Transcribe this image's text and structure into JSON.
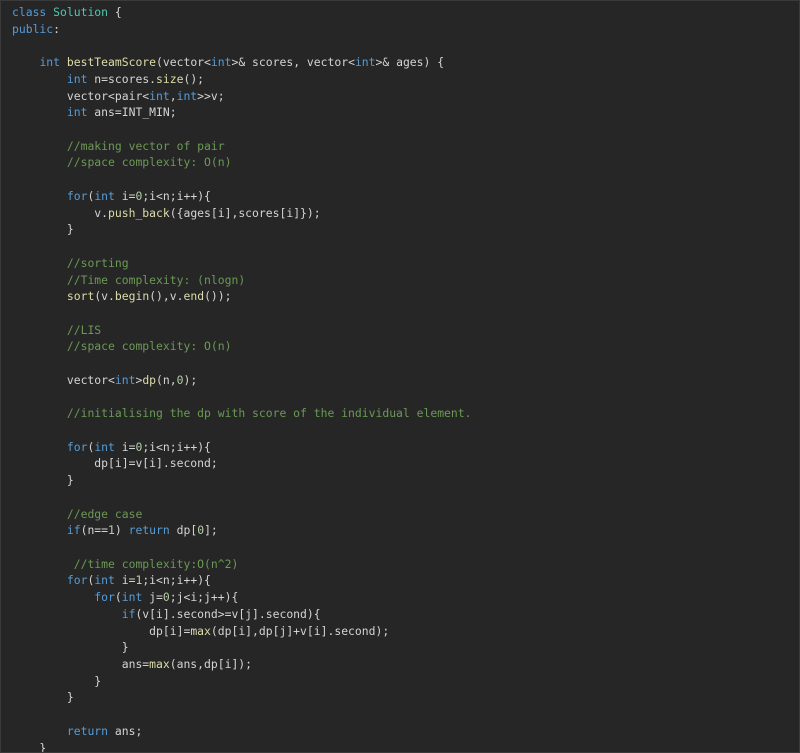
{
  "editor": {
    "theme": {
      "background": "#262626",
      "plain": "#d4d4d4",
      "keyword": "#569cd6",
      "function": "#dcdcaa",
      "number": "#b5cea8",
      "comment": "#6a9955",
      "class": "#4ec9b0"
    },
    "lines": [
      [
        [
          "kw",
          "class"
        ],
        [
          "plain",
          " "
        ],
        [
          "cls",
          "Solution"
        ],
        [
          "plain",
          " {"
        ]
      ],
      [
        [
          "kw",
          "public"
        ],
        [
          "plain",
          ":"
        ]
      ],
      [],
      [
        [
          "plain",
          "    "
        ],
        [
          "type",
          "int"
        ],
        [
          "plain",
          " "
        ],
        [
          "fn",
          "bestTeamScore"
        ],
        [
          "plain",
          "(vector<"
        ],
        [
          "type",
          "int"
        ],
        [
          "plain",
          ">& scores, vector<"
        ],
        [
          "type",
          "int"
        ],
        [
          "plain",
          ">& ages) {"
        ]
      ],
      [
        [
          "plain",
          "        "
        ],
        [
          "type",
          "int"
        ],
        [
          "plain",
          " n=scores."
        ],
        [
          "fn",
          "size"
        ],
        [
          "plain",
          "();"
        ]
      ],
      [
        [
          "plain",
          "        vector<pair<"
        ],
        [
          "type",
          "int"
        ],
        [
          "plain",
          ","
        ],
        [
          "type",
          "int"
        ],
        [
          "plain",
          ">>v;"
        ]
      ],
      [
        [
          "plain",
          "        "
        ],
        [
          "type",
          "int"
        ],
        [
          "plain",
          " ans=INT_MIN;"
        ]
      ],
      [],
      [
        [
          "plain",
          "        "
        ],
        [
          "cm",
          "//making vector of pair"
        ]
      ],
      [
        [
          "plain",
          "        "
        ],
        [
          "cm",
          "//space complexity: O(n)"
        ]
      ],
      [],
      [
        [
          "plain",
          "        "
        ],
        [
          "kw",
          "for"
        ],
        [
          "plain",
          "("
        ],
        [
          "type",
          "int"
        ],
        [
          "plain",
          " i="
        ],
        [
          "num",
          "0"
        ],
        [
          "plain",
          ";i<n;i++){"
        ]
      ],
      [
        [
          "plain",
          "            v."
        ],
        [
          "fn",
          "push_back"
        ],
        [
          "plain",
          "({ages[i],scores[i]});"
        ]
      ],
      [
        [
          "plain",
          "        }"
        ]
      ],
      [],
      [
        [
          "plain",
          "        "
        ],
        [
          "cm",
          "//sorting"
        ]
      ],
      [
        [
          "plain",
          "        "
        ],
        [
          "cm",
          "//Time complexity: (nlogn)"
        ]
      ],
      [
        [
          "plain",
          "        "
        ],
        [
          "fn",
          "sort"
        ],
        [
          "plain",
          "(v."
        ],
        [
          "fn",
          "begin"
        ],
        [
          "plain",
          "(),v."
        ],
        [
          "fn",
          "end"
        ],
        [
          "plain",
          "());"
        ]
      ],
      [],
      [
        [
          "plain",
          "        "
        ],
        [
          "cm",
          "//LIS"
        ]
      ],
      [
        [
          "plain",
          "        "
        ],
        [
          "cm",
          "//space complexity: O(n)"
        ]
      ],
      [],
      [
        [
          "plain",
          "        vector<"
        ],
        [
          "type",
          "int"
        ],
        [
          "plain",
          ">"
        ],
        [
          "fn",
          "dp"
        ],
        [
          "plain",
          "(n,"
        ],
        [
          "num",
          "0"
        ],
        [
          "plain",
          ");"
        ]
      ],
      [],
      [
        [
          "plain",
          "        "
        ],
        [
          "cm",
          "//initialising the dp with score of the individual element."
        ]
      ],
      [],
      [
        [
          "plain",
          "        "
        ],
        [
          "kw",
          "for"
        ],
        [
          "plain",
          "("
        ],
        [
          "type",
          "int"
        ],
        [
          "plain",
          " i="
        ],
        [
          "num",
          "0"
        ],
        [
          "plain",
          ";i<n;i++){"
        ]
      ],
      [
        [
          "plain",
          "            dp[i]=v[i].second;"
        ]
      ],
      [
        [
          "plain",
          "        }"
        ]
      ],
      [],
      [
        [
          "plain",
          "        "
        ],
        [
          "cm",
          "//edge case"
        ]
      ],
      [
        [
          "plain",
          "        "
        ],
        [
          "kw",
          "if"
        ],
        [
          "plain",
          "(n=="
        ],
        [
          "num",
          "1"
        ],
        [
          "plain",
          ") "
        ],
        [
          "kw",
          "return"
        ],
        [
          "plain",
          " dp["
        ],
        [
          "num",
          "0"
        ],
        [
          "plain",
          "];"
        ]
      ],
      [],
      [
        [
          "plain",
          "         "
        ],
        [
          "cm",
          "//time complexity:O(n^2)"
        ]
      ],
      [
        [
          "plain",
          "        "
        ],
        [
          "kw",
          "for"
        ],
        [
          "plain",
          "("
        ],
        [
          "type",
          "int"
        ],
        [
          "plain",
          " i="
        ],
        [
          "num",
          "1"
        ],
        [
          "plain",
          ";i<n;i++){"
        ]
      ],
      [
        [
          "plain",
          "            "
        ],
        [
          "kw",
          "for"
        ],
        [
          "plain",
          "("
        ],
        [
          "type",
          "int"
        ],
        [
          "plain",
          " j="
        ],
        [
          "num",
          "0"
        ],
        [
          "plain",
          ";j<i;j++){"
        ]
      ],
      [
        [
          "plain",
          "                "
        ],
        [
          "kw",
          "if"
        ],
        [
          "plain",
          "(v[i].second>=v[j].second){"
        ]
      ],
      [
        [
          "plain",
          "                    dp[i]="
        ],
        [
          "fn",
          "max"
        ],
        [
          "plain",
          "(dp[i],dp[j]+v[i].second);"
        ]
      ],
      [
        [
          "plain",
          "                }"
        ]
      ],
      [
        [
          "plain",
          "                ans="
        ],
        [
          "fn",
          "max"
        ],
        [
          "plain",
          "(ans,dp[i]);"
        ]
      ],
      [
        [
          "plain",
          "            }"
        ]
      ],
      [
        [
          "plain",
          "        }"
        ]
      ],
      [],
      [
        [
          "plain",
          "        "
        ],
        [
          "kw",
          "return"
        ],
        [
          "plain",
          " ans;"
        ]
      ],
      [
        [
          "plain",
          "    }"
        ]
      ]
    ]
  }
}
